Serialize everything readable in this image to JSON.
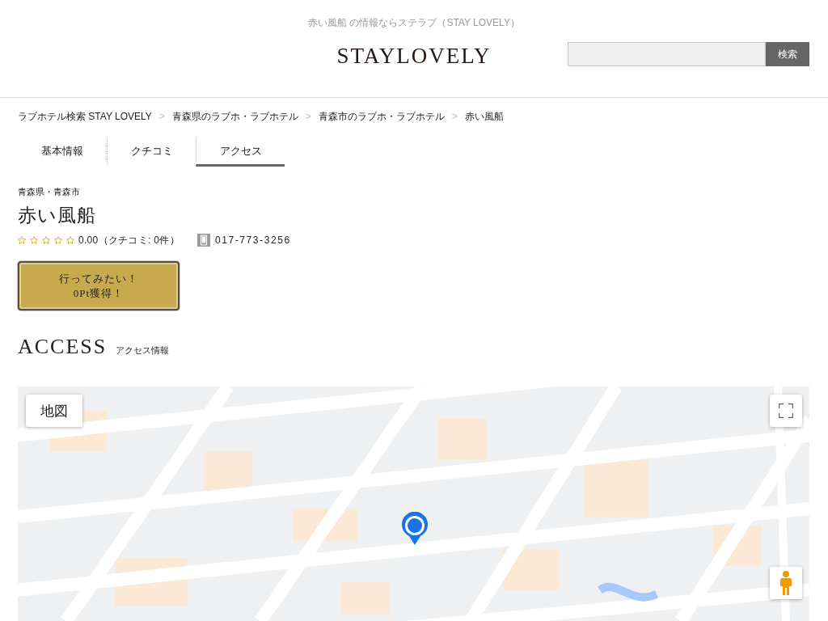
{
  "header": {
    "tagline": "赤い風船 の情報ならステラブ（STAY LOVELY）",
    "logo": "STAYLOVELY",
    "search": {
      "button": "検索"
    }
  },
  "breadcrumb": [
    {
      "kind": "link",
      "text": "ラブホテル検索 STAY LOVELY"
    },
    {
      "kind": "separator",
      "text": ">"
    },
    {
      "kind": "link",
      "text": "青森県のラブホ・ラブホテル"
    },
    {
      "kind": "separator",
      "text": ">"
    },
    {
      "kind": "link",
      "text": "青森市のラブホ・ラブホテル"
    },
    {
      "kind": "separator",
      "text": ">"
    },
    {
      "kind": "current",
      "text": "赤い風船"
    }
  ],
  "tabs": [
    {
      "label": "基本情報",
      "selected": false
    },
    {
      "label": "クチコミ",
      "selected": false
    },
    {
      "label": "アクセス",
      "selected": true
    }
  ],
  "hotel": {
    "area": "青森県・青森市",
    "name": "赤い風船",
    "stars": 0,
    "rating": "0.00（クチコミ: 0件）",
    "phone": "017-773-3256",
    "wish_button": [
      "行ってみたい！",
      "0Pt獲得！"
    ]
  },
  "access": {
    "title": "ACCESS",
    "subtitle": "アクセス情報",
    "map": {
      "map_type_button": "地図"
    }
  }
}
